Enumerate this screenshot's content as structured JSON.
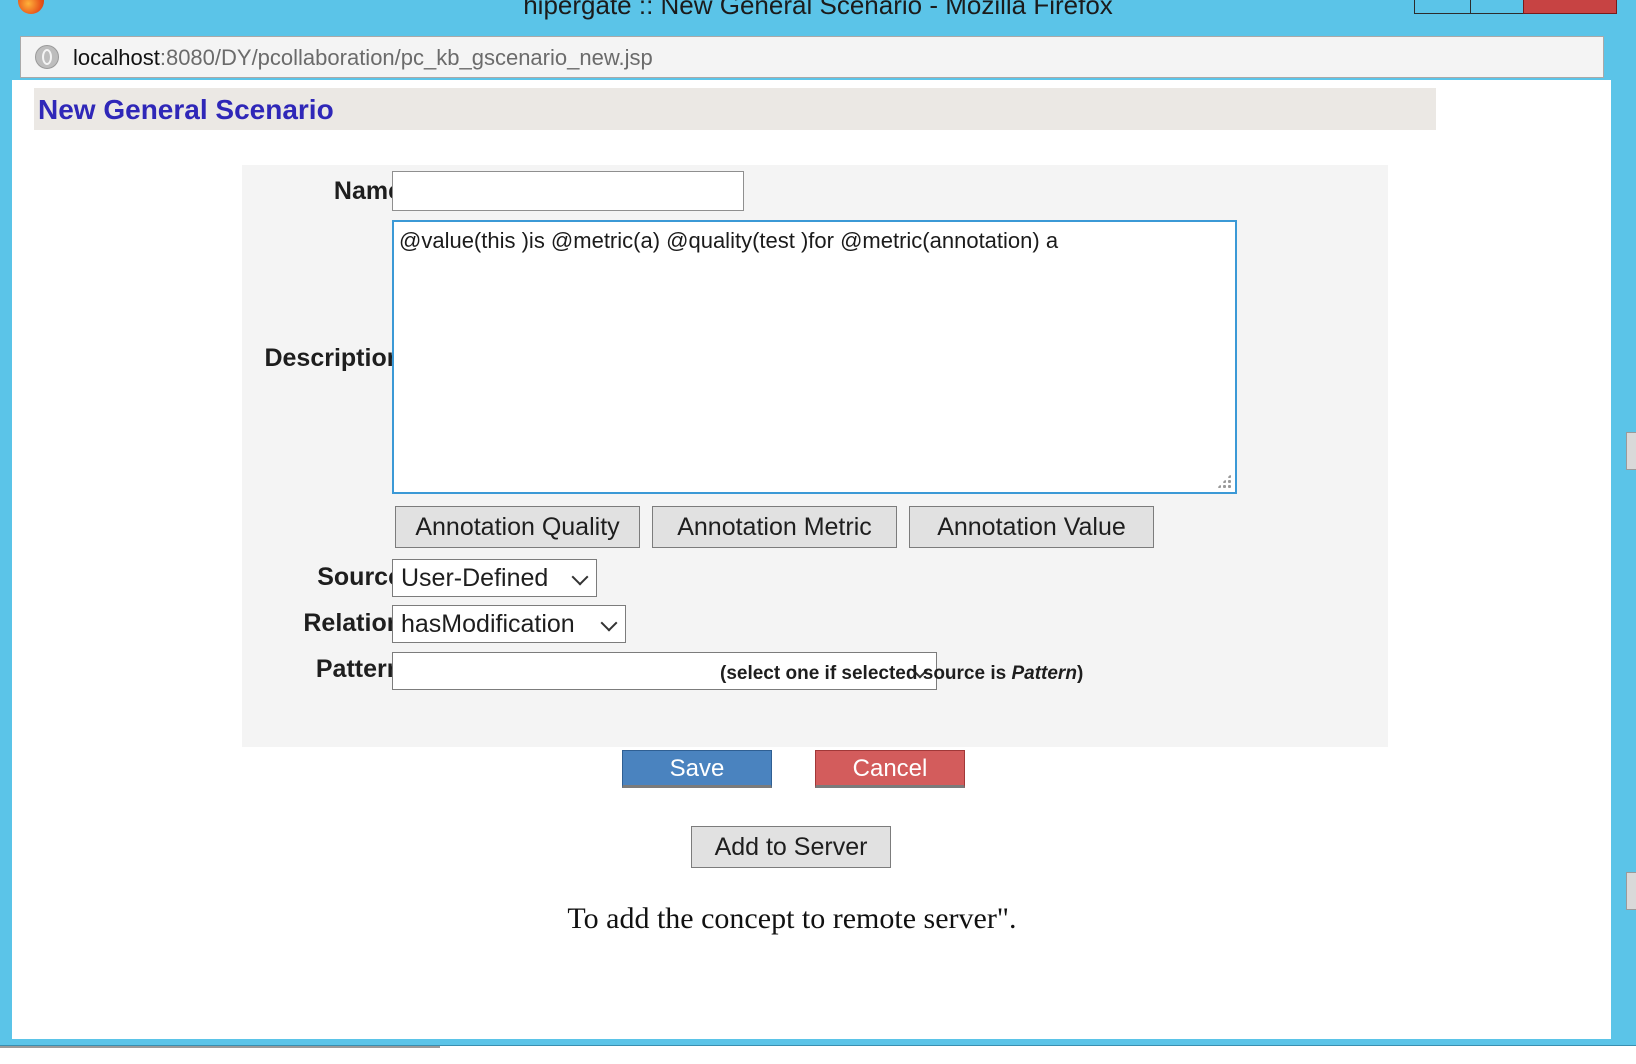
{
  "window": {
    "title": "hipergate :: New General Scenario - Mozilla Firefox"
  },
  "address_bar": {
    "host": "localhost",
    "path": ":8080/DY/pcollaboration/pc_kb_gscenario_new.jsp"
  },
  "page": {
    "title": "New General Scenario"
  },
  "form": {
    "name_label": "Name",
    "name_value": "",
    "description_label": "Description",
    "description_value": "@value(this )is @metric(a) @quality(test )for @metric(annotation) a",
    "annotation_buttons": [
      "Annotation Quality",
      "Annotation Metric",
      "Annotation Value"
    ],
    "source_label": "Source",
    "source_value": "User-Defined",
    "relation_label": "Relation",
    "relation_value": "hasModification",
    "pattern_label": "Pattern",
    "pattern_value": "",
    "pattern_hint": "(select one if selected source is ",
    "pattern_hint_em": "Pattern",
    "pattern_hint_end": ")"
  },
  "actions": {
    "save_label": "Save",
    "cancel_label": "Cancel",
    "add_to_server_label": "Add to Server",
    "note": "To add the concept to remote server\"."
  },
  "colors": {
    "window_frame": "#5bc4e8",
    "page_title": "#2f27b8",
    "save_button": "#4a83bf",
    "cancel_button": "#d35c5c",
    "textarea_focus": "#3b99d6"
  }
}
